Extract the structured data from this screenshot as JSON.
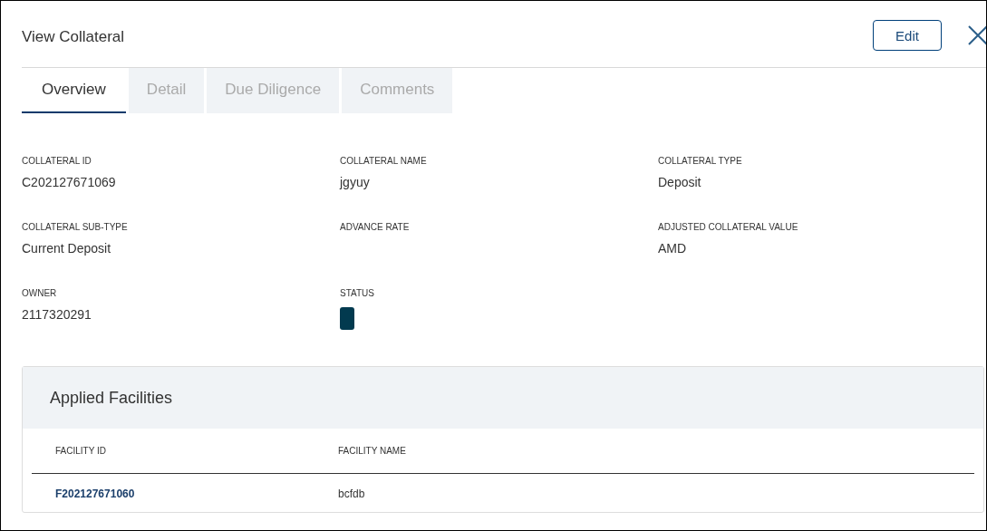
{
  "header": {
    "title": "View Collateral",
    "edit_button": "Edit"
  },
  "tabs": [
    {
      "label": "Overview",
      "selected": true
    },
    {
      "label": "Detail",
      "selected": false
    },
    {
      "label": "Due Diligence",
      "selected": false
    },
    {
      "label": "Comments",
      "selected": false
    }
  ],
  "fields": [
    {
      "label": "COLLATERAL ID",
      "kind": "text",
      "value": "C202127671069"
    },
    {
      "label": "COLLATERAL NAME",
      "kind": "text",
      "value": "jgyuy"
    },
    {
      "label": "COLLATERAL TYPE",
      "kind": "text",
      "value": "Deposit"
    },
    {
      "label": "COLLATERAL SUB-TYPE",
      "kind": "text",
      "value": "Current Deposit"
    },
    {
      "label": "ADVANCE RATE",
      "kind": "text"
    },
    {
      "label": "ADJUSTED COLLATERAL VALUE",
      "kind": "text",
      "value": "AMD"
    },
    {
      "label": "OWNER",
      "kind": "text",
      "value": "2117320291"
    },
    {
      "label": "STATUS",
      "kind": "badge"
    }
  ],
  "applied_facilities": {
    "title": "Applied Facilities",
    "columns": [
      "FACILITY ID",
      "FACILITY NAME"
    ],
    "rows": [
      [
        "F202127671060",
        "bcfdb"
      ]
    ]
  }
}
